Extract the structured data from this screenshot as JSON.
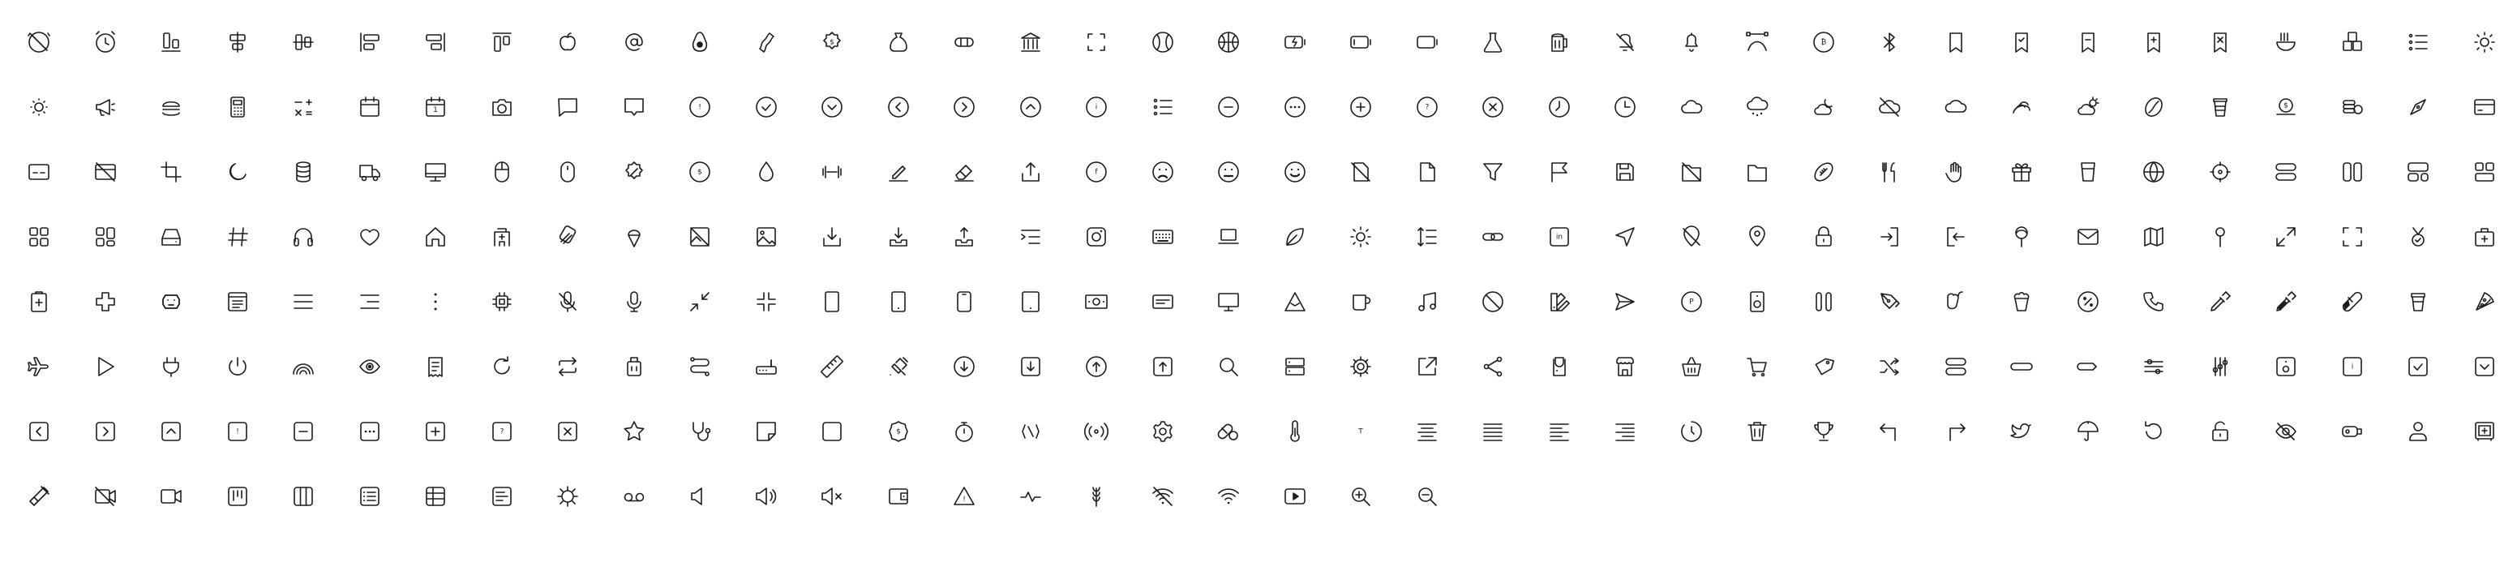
{
  "icons": [
    "alarm-off",
    "alarm-clock",
    "align-bottom",
    "align-center-h",
    "align-center-v",
    "align-left",
    "align-right",
    "align-top",
    "apple",
    "at-sign",
    "avocado",
    "bacon",
    "badge-dollar",
    "bag-dollar",
    "bandage",
    "bank",
    "scan-frame",
    "baseball",
    "basketball",
    "battery-charging",
    "battery-low",
    "battery-empty",
    "beaker",
    "beer-mug",
    "bell-off",
    "bell",
    "bezier-curve",
    "bitcoin",
    "bluetooth",
    "bookmark",
    "bookmark-check",
    "bookmark-minus",
    "bookmark-plus",
    "bookmark-x",
    "ramen-bowl",
    "boxes",
    "bullet-list",
    "brightness-high",
    "brightness-low",
    "megaphone",
    "burger",
    "calculator",
    "calculator-signs",
    "calendar",
    "calendar-day",
    "camera",
    "chat-bubble",
    "chat-square",
    "alert-circle",
    "check-circle",
    "chevron-down-circle",
    "chevron-left-circle",
    "chevron-right-circle",
    "chevron-up-circle",
    "info-circle",
    "ordered-list",
    "minus-circle",
    "more-circle",
    "plus-circle",
    "help-circle",
    "x-circle",
    "clock-alt",
    "clock",
    "cloud",
    "cloud-snow",
    "cloud-moon",
    "cloud-off",
    "cloud-outline",
    "cloud-wind",
    "cloud-sun",
    "coffee-bean",
    "coffee-cup",
    "coin-dollar",
    "coin-stack",
    "compass",
    "credit-card",
    "credit-card-minus",
    "credit-card-off",
    "crop",
    "moon",
    "database",
    "truck",
    "desktop",
    "mouse",
    "mouse-alt",
    "discount-badge",
    "dollar-circle",
    "droplet",
    "dumbbell",
    "pencil-line",
    "eraser",
    "share-upload",
    "facebook",
    "emoji-sad",
    "emoji-neutral",
    "emoji-happy",
    "file-off",
    "file",
    "filter",
    "flag",
    "floppy-disk",
    "folder-off",
    "folder",
    "football",
    "fork-knife",
    "hand-stop",
    "gift",
    "glass",
    "globe",
    "target",
    "stack-horizontal",
    "columns-layout",
    "layout-panels",
    "layout-dashboard",
    "grid-squares",
    "grid-mixed",
    "hard-drive",
    "hash",
    "headphones",
    "heart",
    "home",
    "hospital",
    "id-cards",
    "ice-cream",
    "image-off",
    "image",
    "inbox-download",
    "tray-download",
    "tray-upload",
    "indent-list",
    "instagram",
    "keyboard",
    "laptop",
    "leaf",
    "sun-bright",
    "line-height",
    "link",
    "linkedin",
    "location-arrow",
    "location-off",
    "map-pin",
    "lock",
    "login",
    "logout",
    "lollipop",
    "mail",
    "map",
    "pin",
    "maximize",
    "fullscreen",
    "medal",
    "medical-case",
    "clipboard-plus",
    "medical-cross",
    "robot-face",
    "window-menu",
    "menu",
    "menu-right",
    "more-vertical",
    "cpu",
    "mic-off",
    "microphone",
    "minimize",
    "minimize-center",
    "tablet",
    "mobile",
    "mobile-notch",
    "tablet-alt",
    "money-bill",
    "money-card",
    "monitor",
    "mountain",
    "mug",
    "music-note",
    "block",
    "palette",
    "send",
    "parking",
    "speaker",
    "pause",
    "pen-nib",
    "pepper",
    "popcorn",
    "percent-circle",
    "phone",
    "pipette",
    "eyedropper",
    "pill",
    "beverage-cup",
    "pizza",
    "plane",
    "play",
    "plug",
    "power",
    "rainbow",
    "eye",
    "receipt",
    "refresh",
    "repeat",
    "luggage",
    "route",
    "router",
    "ruler",
    "satellite",
    "download-circle",
    "download-square",
    "upload-circle",
    "upload-square",
    "search",
    "server",
    "settings-gear",
    "external-link",
    "share",
    "shirt",
    "shop",
    "shopping-basket",
    "shopping-cart",
    "tag",
    "shuffle",
    "capsule",
    "slider-pill",
    "toggle-pill",
    "sliders-horizontal",
    "sliders-vertical",
    "speaker-box",
    "square-info",
    "square-check",
    "square-chevron-down",
    "square-chevron-left",
    "square-chevron-right",
    "square-chevron-up",
    "square-alert",
    "square-minus",
    "square-more",
    "square-plus",
    "square-help",
    "square-x",
    "star",
    "stethoscope",
    "sticky-note",
    "square",
    "coin-badge",
    "stopwatch",
    "nfc",
    "broadcast",
    "cog",
    "pills",
    "thermometer",
    "text-type",
    "align-center-text",
    "align-justify",
    "align-left-text",
    "align-right-text",
    "timer-reset",
    "trash",
    "trophy",
    "arrow-corner-up-left",
    "arrow-corner-up-right",
    "twitter",
    "umbrella",
    "undo",
    "unlock",
    "eye-off",
    "usb-drive",
    "user",
    "safe",
    "vial",
    "video-off",
    "video-camera",
    "trello",
    "columns",
    "list-view",
    "table-view",
    "notes",
    "sun-spin",
    "voicemail",
    "volume-low",
    "volume-medium",
    "volume-mute",
    "wallet",
    "warning",
    "pulse",
    "wheat",
    "wifi-off",
    "wifi",
    "youtube",
    "zoom-in",
    "zoom-out"
  ],
  "glyphs": {
    "alert": "!",
    "help": "?",
    "info": "i",
    "dollar": "$",
    "percent": "%",
    "parking": "P",
    "one": "1",
    "in": "in",
    "f": "f",
    "b": "₿",
    "T": "T"
  }
}
